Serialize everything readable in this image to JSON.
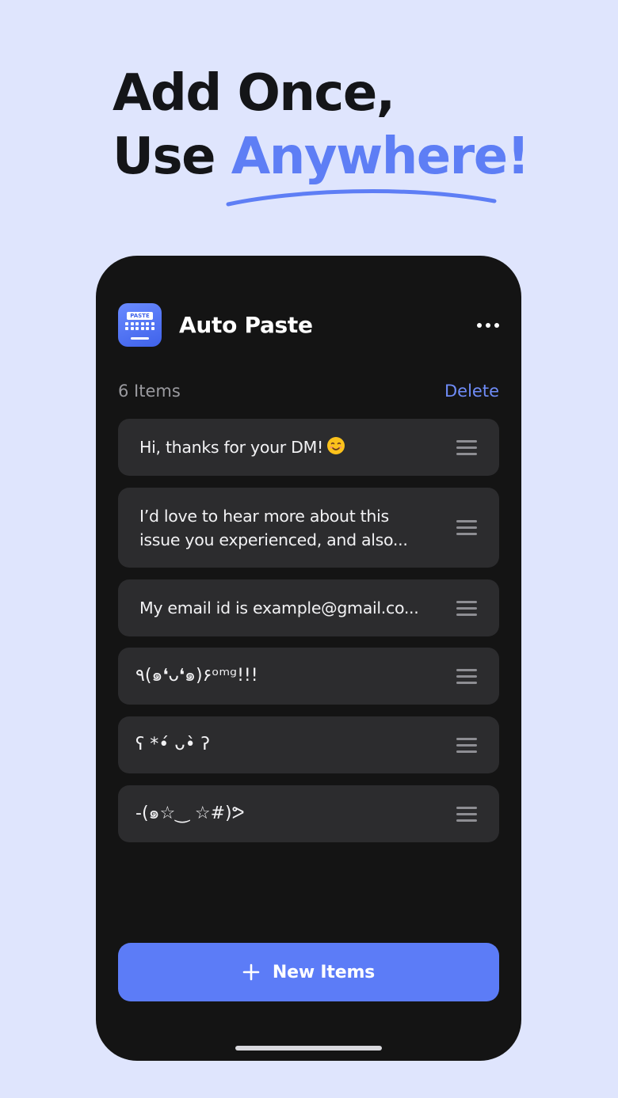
{
  "headline": {
    "line1": "Add Once,",
    "line2_plain": "Use ",
    "line2_accent": "Anywhere!"
  },
  "app": {
    "icon_tag": "PASTE",
    "title": "Auto Paste"
  },
  "list_header": {
    "count_label": "6 Items",
    "delete_label": "Delete"
  },
  "items": [
    {
      "text": "Hi, thanks for your DM!",
      "emoji": "smiling-face"
    },
    {
      "text": "I’d love to hear more about this\nissue you experienced, and also..."
    },
    {
      "text": "My email id is example@gmail.co..."
    },
    {
      "text": "٩(๑❛ᴗ❛๑)۶ᵒᵐᵍ!!!"
    },
    {
      "text": "ʕ *•́ ᴗ•̀ ʔ"
    },
    {
      "text": "-(๑☆‿ ☆#)ᕗ"
    }
  ],
  "actions": {
    "new_items_label": "New Items"
  },
  "colors": {
    "background": "#dfe5fd",
    "accent": "#5e7ef5",
    "phone": "#141414",
    "row": "#2c2c2e",
    "button": "#5c7cf7"
  },
  "icons": [
    "paste-keyboard-app-icon",
    "more-dots-icon",
    "drag-handle-icon",
    "plus-icon",
    "smile-emoji-icon"
  ]
}
